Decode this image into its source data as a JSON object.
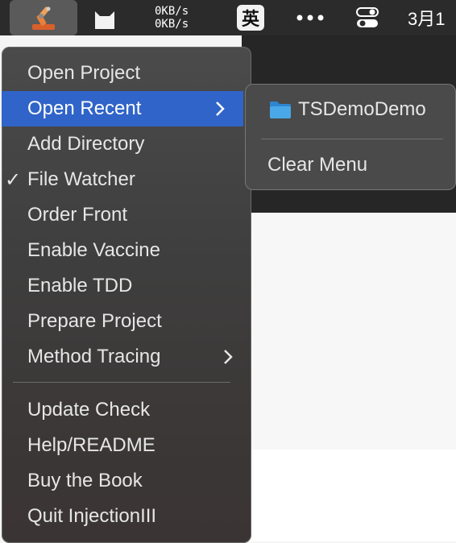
{
  "menubar": {
    "app_icon": "robot-arm-icon",
    "cat_icon": "cat-icon",
    "net_up": "0KB/s",
    "net_down": "0KB/s",
    "ime_label": "英",
    "more_icon": "ellipsis-icon",
    "control_center_icon": "toggles-icon",
    "date": "3月1"
  },
  "menu": {
    "items": [
      {
        "label": "Open Project"
      },
      {
        "label": "Open Recent",
        "highlighted": true,
        "has_submenu": true
      },
      {
        "label": "Add Directory"
      },
      {
        "label": "File Watcher",
        "checked": true,
        "check": "✓"
      },
      {
        "label": "Order Front"
      },
      {
        "label": "Enable Vaccine"
      },
      {
        "label": "Enable TDD"
      },
      {
        "label": "Prepare Project"
      },
      {
        "label": "Method Tracing",
        "has_submenu": true
      },
      {
        "label": "Update Check"
      },
      {
        "label": "Help/README"
      },
      {
        "label": "Buy the Book"
      },
      {
        "label": "Quit InjectionIII"
      }
    ]
  },
  "submenu": {
    "items": [
      {
        "label": "TSDemoDemo",
        "icon": "folder-icon"
      },
      {
        "label": "Clear Menu"
      }
    ]
  },
  "colors": {
    "highlight": "#3064c8",
    "menu_text": "#e6e6e6",
    "folder": "#4aa8e8"
  }
}
